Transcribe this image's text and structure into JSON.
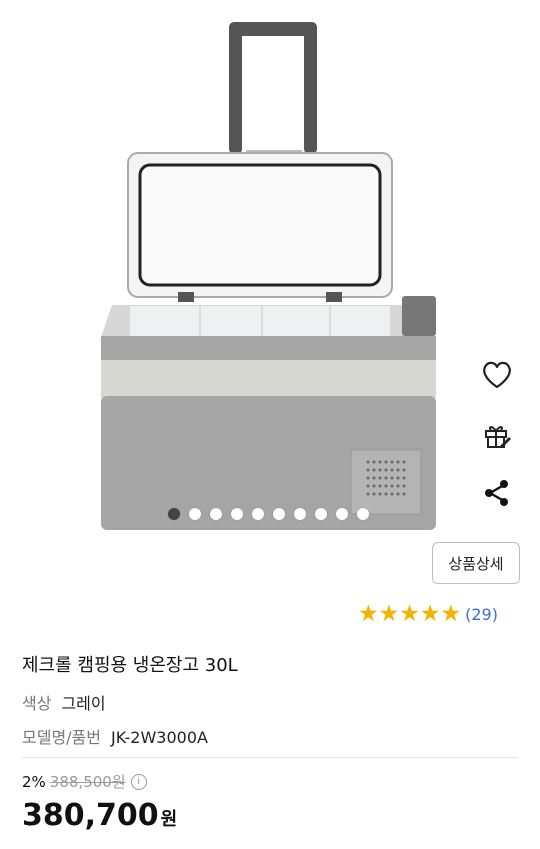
{
  "product": {
    "title": "제크롤 캠핑용 냉온장고 30L",
    "rating_count": "(29)",
    "rating_stars": 5,
    "detail_button": "상품상세",
    "specs": [
      {
        "key": "색상",
        "value": "그레이"
      },
      {
        "key": "모델명/품번",
        "value": "JK-2W3000A"
      }
    ],
    "discount_rate": "2%",
    "original_price": "388,500원",
    "price": "380,700",
    "price_unit": "원"
  },
  "gallery": {
    "total": 10,
    "active_index": 0
  },
  "icons": {
    "wishlist": "heart-icon",
    "gift": "gift-icon",
    "share": "share-icon",
    "info": "info-icon"
  },
  "colors": {
    "star": "#f5b301",
    "rating_link": "#3a6fd8",
    "dot_active": "#444444"
  }
}
